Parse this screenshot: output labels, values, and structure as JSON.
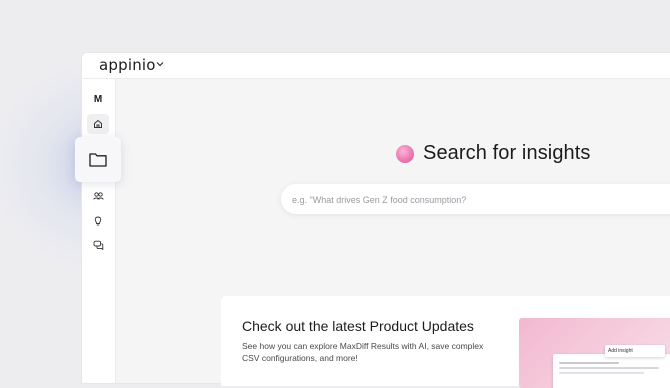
{
  "app": {
    "logo_text": "appinio",
    "workspace_initial": "M"
  },
  "sidebar": {
    "items": [
      {
        "icon": "home-icon"
      },
      {
        "icon": "folder-icon"
      },
      {
        "icon": "users-icon"
      },
      {
        "icon": "lightbulb-icon"
      },
      {
        "icon": "chat-icon"
      }
    ]
  },
  "hero": {
    "title": "Search for insights"
  },
  "search": {
    "placeholder": "e.g. \"What drives Gen Z food consumption?"
  },
  "updates": {
    "title": "Check out the latest Product Updates",
    "description": "See how you can explore MaxDiff Results with AI, save complex CSV configurations, and more!",
    "thumbnail_button": "Add insight"
  },
  "colors": {
    "accent_pink": "#ea6aa8",
    "background": "#ededf0"
  }
}
